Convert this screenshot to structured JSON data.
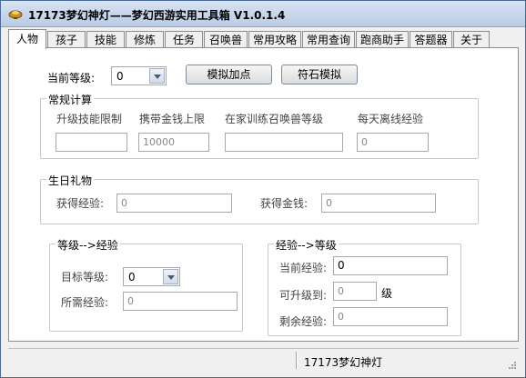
{
  "window": {
    "title": "17173梦幻神灯——梦幻西游实用工具箱 V1.0.1.4",
    "app_icon": "lamp-icon"
  },
  "tabs": [
    {
      "label": "人物",
      "active": true
    },
    {
      "label": "孩子"
    },
    {
      "label": "技能"
    },
    {
      "label": "修炼"
    },
    {
      "label": "任务"
    },
    {
      "label": "召唤兽"
    },
    {
      "label": "常用攻略"
    },
    {
      "label": "常用查询"
    },
    {
      "label": "跑商助手"
    },
    {
      "label": "答题器"
    },
    {
      "label": "关于"
    }
  ],
  "top": {
    "current_level_label": "当前等级:",
    "current_level_value": "0",
    "btn_simulate_points": "模拟加点",
    "btn_rune_simulate": "符石模拟"
  },
  "regular_calc": {
    "title": "常规计算",
    "col1_label": "升级技能限制",
    "col1_value": "",
    "col2_label": "携带金钱上限",
    "col2_value": "10000",
    "col3_label": "在家训练召唤兽等级",
    "col3_value": "",
    "col4_label": "每天离线经验",
    "col4_value": "0"
  },
  "birthday": {
    "title": "生日礼物",
    "exp_label": "获得经验:",
    "exp_value": "0",
    "money_label": "获得金钱:",
    "money_value": "0"
  },
  "level_to_exp": {
    "title": "等级-->经验",
    "target_label": "目标等级:",
    "target_value": "0",
    "need_label": "所需经验:",
    "need_value": "0"
  },
  "exp_to_level": {
    "title": "经验-->等级",
    "current_exp_label": "当前经验:",
    "current_exp_value": "0",
    "upgrade_label": "可升级到:",
    "upgrade_value": "0",
    "upgrade_unit": "级",
    "remain_label": "剩余经验:",
    "remain_value": "0"
  },
  "status": {
    "text": "17173梦幻神灯"
  }
}
